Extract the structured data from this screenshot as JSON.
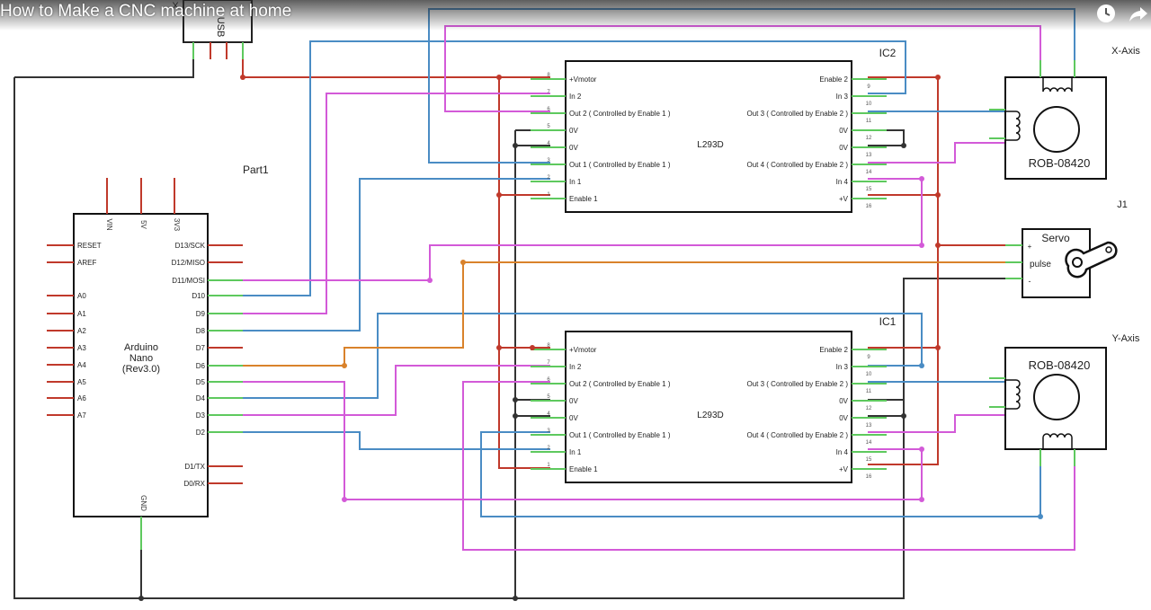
{
  "video": {
    "title": "How to Make a CNC machine at home",
    "icons": [
      "clock-icon",
      "share-icon"
    ]
  },
  "usb": {
    "label": "USB",
    "pin_mark": "X"
  },
  "arduino": {
    "part_label": "Part1",
    "name_lines": [
      "Arduino",
      "Nano",
      "(Rev3.0)"
    ],
    "top_pins": [
      "VIN",
      "5V",
      "3V3"
    ],
    "left_pins": [
      "RESET",
      "AREF",
      "A0",
      "A1",
      "A2",
      "A3",
      "A4",
      "A5",
      "A6",
      "A7"
    ],
    "right_pins": [
      "D13/SCK",
      "D12/MISO",
      "D11/MOSI",
      "D10",
      "D9",
      "D8",
      "D7",
      "D6",
      "D5",
      "D4",
      "D3",
      "D2",
      "D1/TX",
      "D0/RX"
    ],
    "bottom_pin": "GND"
  },
  "driver": {
    "chip": "L293D",
    "left_pins": [
      "+Vmotor",
      "In 2",
      "Out 2 ( Controlled by Enable 1 )",
      "0V",
      "0V",
      "Out 1 ( Controlled by Enable 1 )",
      "In 1",
      "Enable 1"
    ],
    "left_numbers": [
      "8",
      "7",
      "6",
      "5",
      "4",
      "3",
      "2",
      "1"
    ],
    "right_pins": [
      "Enable 2",
      "In 3",
      "Out 3 ( Controlled by Enable 2 )",
      "0V",
      "0V",
      "Out 4 ( Controlled by Enable 2 )",
      "In 4",
      "+V"
    ],
    "right_numbers": [
      "9",
      "10",
      "11",
      "12",
      "13",
      "14",
      "15",
      "16"
    ]
  },
  "ic2": {
    "label": "IC2"
  },
  "ic1": {
    "label": "IC1"
  },
  "x_motor": {
    "axis_label": "X-Axis",
    "part": "ROB-08420"
  },
  "y_motor": {
    "axis_label": "Y-Axis",
    "part": "ROB-08420"
  },
  "servo": {
    "ref": "J1",
    "title": "Servo",
    "pulse": "pulse",
    "plus": "+",
    "minus": "-"
  },
  "colors": {
    "red": "#c0392b",
    "blue": "#4a8cc4",
    "magenta": "#d35ad8",
    "orange": "#d9822b",
    "black": "#333333",
    "green": "#5ec95e",
    "pin_red": "#c0392b"
  }
}
